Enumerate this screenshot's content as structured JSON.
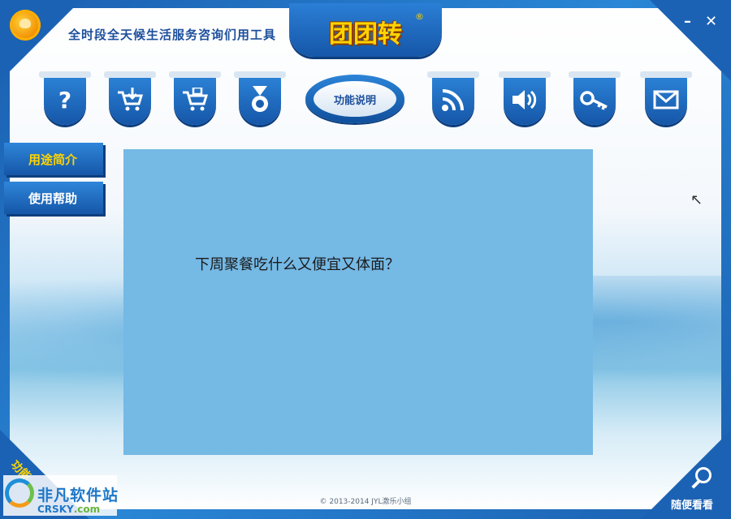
{
  "header": {
    "tagline": "全时段全天候生活服务咨询们用工具",
    "app_name": "团团转",
    "registered": "®",
    "minimize_label": "–",
    "close_label": "✕"
  },
  "toolbar": {
    "help_glyph": "?",
    "download_glyph": "⇩",
    "cart_glyph": "🛒",
    "award_glyph": "✹",
    "feature_label": "功能说明",
    "rss_glyph": "◉",
    "sound_glyph": "🔊",
    "key_glyph": "⚿",
    "mail_glyph": "✉"
  },
  "sidebar": {
    "items": [
      {
        "label": "用途简介"
      },
      {
        "label": "使用帮助"
      }
    ]
  },
  "main": {
    "content_text": "下周聚餐吃什么又便宜又体面？"
  },
  "footer": {
    "copyright": "© 2013-2014 JYL激乐小组",
    "browse_label": "随便看看",
    "corner_label": "功能"
  },
  "watermark": {
    "cn": "非凡软件站",
    "en_main": "CRSKY",
    "en_suffix": ".com"
  },
  "colors": {
    "accent_blue": "#1556a8",
    "panel_blue": "#75b9e5",
    "highlight_yellow": "#ffd400"
  }
}
